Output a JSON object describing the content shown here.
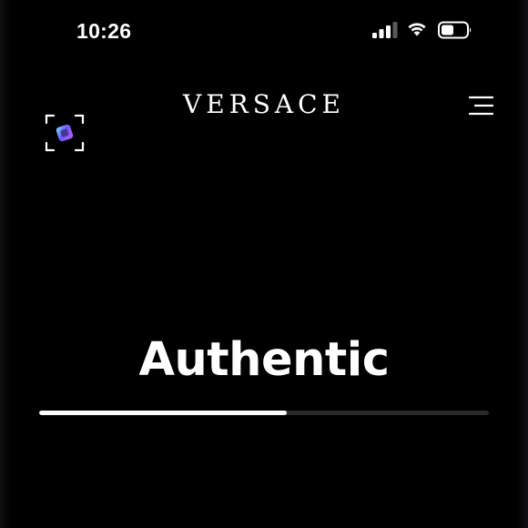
{
  "status_bar": {
    "time": "10:26",
    "signal_icon": "cellular-signal-icon",
    "wifi_icon": "wifi-icon",
    "battery_icon": "battery-icon"
  },
  "header": {
    "brand": "VERSACE",
    "scan_icon": "scan-viewfinder-icon",
    "menu_icon": "hamburger-menu-icon"
  },
  "main": {
    "headline": "Authentic",
    "progress_fraction": 0.55
  },
  "colors": {
    "background": "#000000",
    "foreground": "#ffffff",
    "track": "#2a2a2a"
  }
}
